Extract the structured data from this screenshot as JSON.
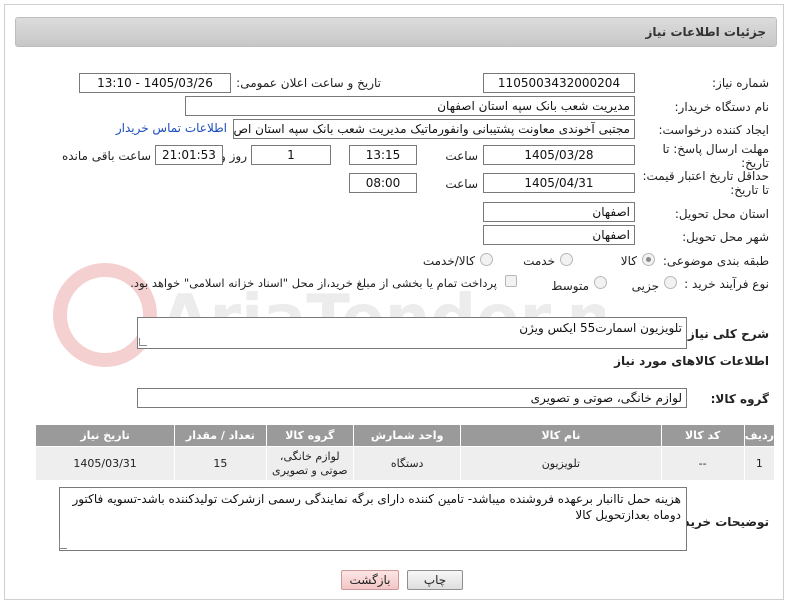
{
  "header": {
    "title": "جزئیات اطلاعات نیاز"
  },
  "fields": {
    "need_number_label": "شماره نیاز:",
    "need_number": "1105003432000204",
    "announce_label": "تاریخ و ساعت اعلان عمومی:",
    "announce_value": "1405/03/26 - 13:10",
    "buyer_org_label": "نام دستگاه خریدار:",
    "buyer_org": "مدیریت شعب بانک سپه استان اصفهان",
    "requester_label": "ایجاد کننده درخواست:",
    "requester": "مجتبی آخوندی معاونت پشتیبانی وانفورماتیک مدیریت شعب بانک سپه استان اص",
    "contact_link": "اطلاعات تماس خریدار",
    "deadline_label": "مهلت ارسال پاسخ: تا تاریخ:",
    "deadline_date": "1405/03/28",
    "time_label": "ساعت",
    "deadline_time": "13:15",
    "days_value": "1",
    "days_label": "روز و",
    "remaining_value": "21:01:53",
    "remaining_label": "ساعت باقی مانده",
    "price_label": "حداقل تاریخ اعتبار قیمت: تا تاریخ:",
    "price_date": "1405/04/31",
    "price_time": "08:00",
    "province_label": "استان محل تحویل:",
    "province": "اصفهان",
    "city_label": "شهر محل تحویل:",
    "city": "اصفهان",
    "category_label": "طبقه بندی موضوعی:",
    "cat_goods": "کالا",
    "cat_service": "خدمت",
    "cat_goods_service": "کالا/خدمت",
    "purchase_label": "نوع فرآیند خرید :",
    "purchase_partial": "جزیی",
    "purchase_medium": "متوسط",
    "purchase_note": "پرداخت تمام یا بخشی از مبلغ خرید،از محل \"اسناد خزانه اسلامی\" خواهد بود."
  },
  "description": {
    "label": "شرح کلی نیاز:",
    "value": "تلویزیون اسمارت55 ایکس ویژن"
  },
  "goods_section_title": "اطلاعات کالاهای مورد نیاز",
  "goods_group": {
    "label": "گروه کالا:",
    "value": "لوازم خانگی، صوتی و تصویری"
  },
  "table": {
    "headers": [
      "ردیف",
      "کد کالا",
      "نام کالا",
      "واحد شمارش",
      "گروه کالا",
      "تعداد / مقدار",
      "تاریخ نیاز"
    ],
    "rows": [
      [
        "1",
        "--",
        "تلویزیون",
        "دستگاه",
        "لوازم خانگی، صوتی و تصویری",
        "15",
        "1405/03/31"
      ]
    ]
  },
  "buyer_notes": {
    "label": "توضیحات خریدار:",
    "value": "هزینه حمل تاانبار برعهده فروشنده میباشد- تامین کننده دارای برگه نمایندگی رسمی ازشرکت تولیدکننده باشد-تسویه فاکتور دوماه بعدازتحویل کالا"
  },
  "buttons": {
    "print": "چاپ",
    "back": "بازگشت"
  },
  "watermark": "AriaTender.net"
}
